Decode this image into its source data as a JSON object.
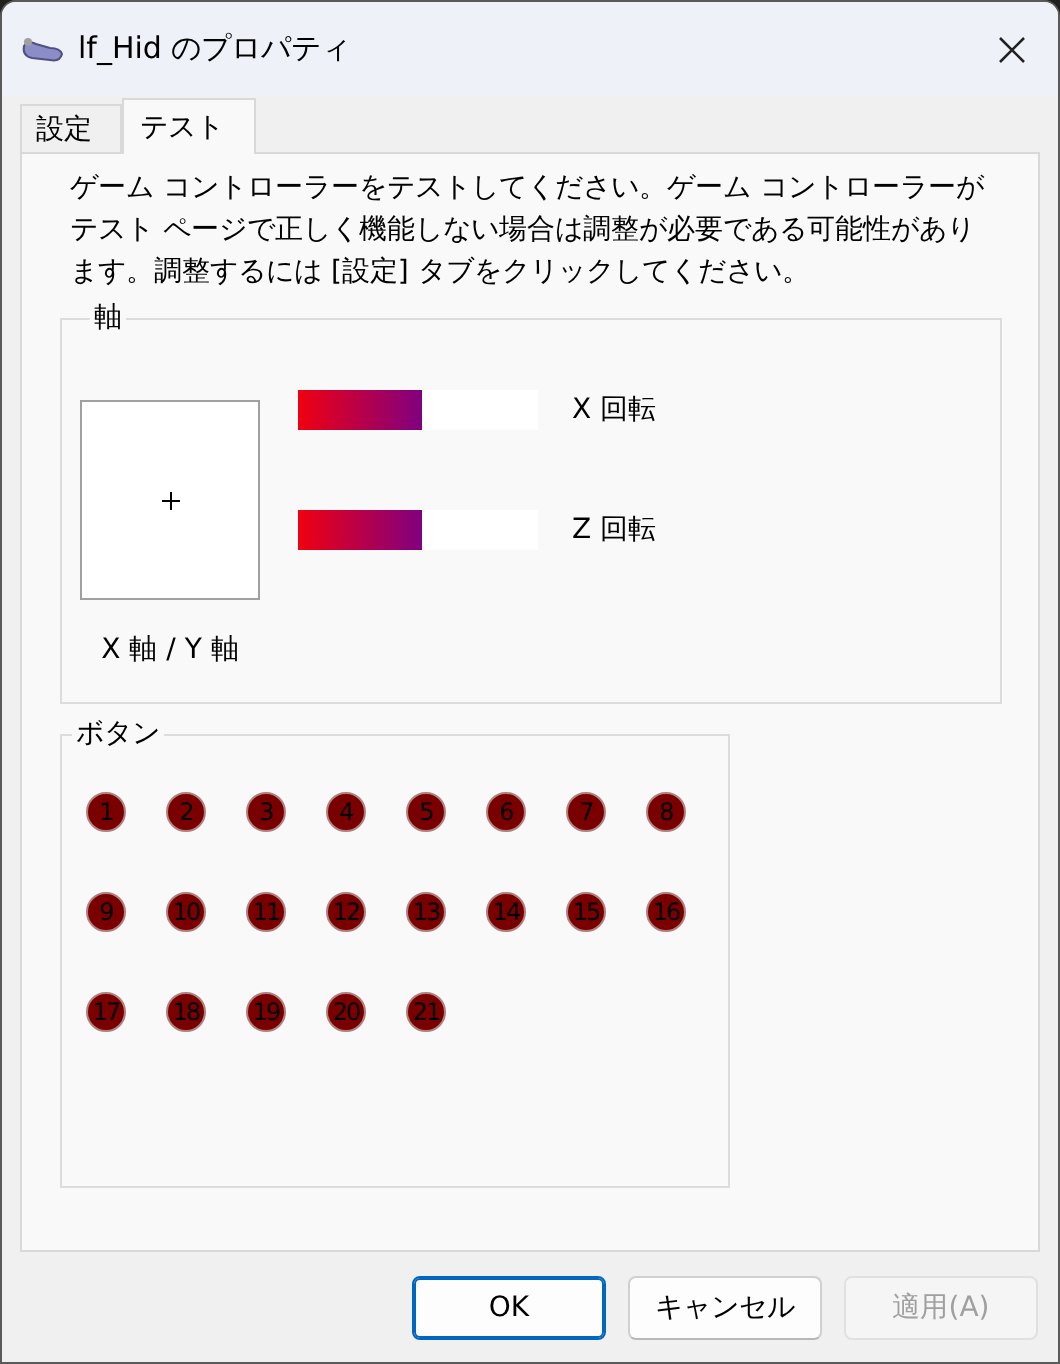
{
  "window": {
    "title": "lf_Hid のプロパティ"
  },
  "tabs": [
    {
      "label": "設定",
      "selected": false
    },
    {
      "label": "テスト",
      "selected": true
    }
  ],
  "description": "ゲーム コントローラーをテストしてください。ゲーム コントローラーがテスト ページで正しく機能しない場合は調整が必要である可能性があります。調整するには [設定] タブをクリックしてください。",
  "axes": {
    "label": "軸",
    "xy_label": "X 軸 / Y 軸",
    "bars": [
      {
        "label": "X 回転",
        "level": 0.52
      },
      {
        "label": "Z 回転",
        "level": 0.52
      }
    ]
  },
  "buttons_group": {
    "label": "ボタン",
    "buttons": [
      {
        "label": "1",
        "pressed": false
      },
      {
        "label": "2",
        "pressed": false
      },
      {
        "label": "3",
        "pressed": false
      },
      {
        "label": "4",
        "pressed": false
      },
      {
        "label": "5",
        "pressed": false
      },
      {
        "label": "6",
        "pressed": false
      },
      {
        "label": "7",
        "pressed": false
      },
      {
        "label": "8",
        "pressed": false
      },
      {
        "label": "9",
        "pressed": false
      },
      {
        "label": "10",
        "pressed": false
      },
      {
        "label": "11",
        "pressed": false
      },
      {
        "label": "12",
        "pressed": false
      },
      {
        "label": "13",
        "pressed": false
      },
      {
        "label": "14",
        "pressed": false
      },
      {
        "label": "15",
        "pressed": false
      },
      {
        "label": "16",
        "pressed": false
      },
      {
        "label": "17",
        "pressed": false
      },
      {
        "label": "18",
        "pressed": false
      },
      {
        "label": "19",
        "pressed": false
      },
      {
        "label": "20",
        "pressed": false
      },
      {
        "label": "21",
        "pressed": false
      }
    ]
  },
  "footer": [
    {
      "label": "OK",
      "kind": "default",
      "disabled": false
    },
    {
      "label": "キャンセル",
      "kind": "normal",
      "disabled": false
    },
    {
      "label": "適用(A)",
      "kind": "normal",
      "disabled": true
    }
  ]
}
